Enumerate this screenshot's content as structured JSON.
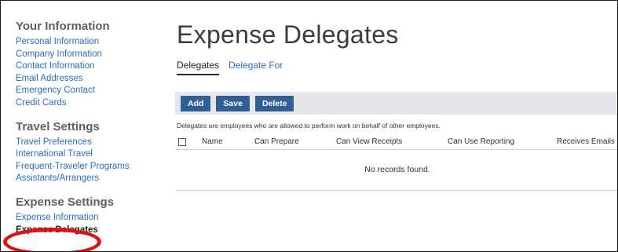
{
  "sidebar": {
    "sections": [
      {
        "title": "Your Information",
        "links": [
          "Personal Information",
          "Company Information",
          "Contact Information",
          "Email Addresses",
          "Emergency Contact",
          "Credit Cards"
        ]
      },
      {
        "title": "Travel Settings",
        "links": [
          "Travel Preferences",
          "International Travel",
          "Frequent-Traveler Programs",
          "Assistants/Arrangers"
        ]
      },
      {
        "title": "Expense Settings",
        "links": [
          "Expense Information",
          "Expense Delegates"
        ]
      }
    ]
  },
  "main": {
    "title": "Expense Delegates",
    "tabs": [
      "Delegates",
      "Delegate For"
    ],
    "toolbar": {
      "add_label": "Add",
      "save_label": "Save",
      "delete_label": "Delete"
    },
    "description": "Delegates are employees who are allowed to perform work on behalf of other employees.",
    "table": {
      "columns": [
        "Name",
        "Can Prepare",
        "Can View Receipts",
        "Can Use Reporting",
        "Receives Emails"
      ],
      "empty_text": "No records found."
    }
  },
  "colors": {
    "link": "#2a6ebb",
    "button": "#2f5f96",
    "toolbar_bg": "#e5e7ea",
    "highlight": "#e20f14"
  }
}
